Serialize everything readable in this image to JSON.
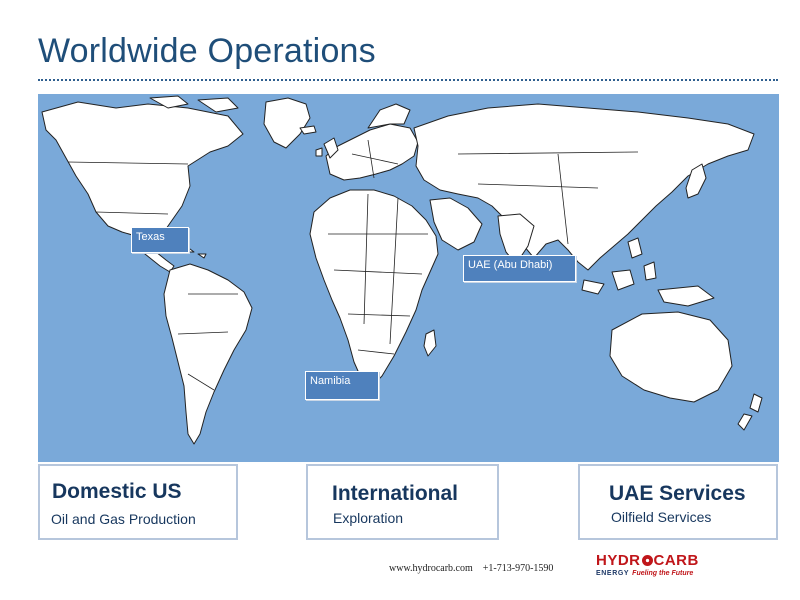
{
  "slide": {
    "title": "Worldwide Operations"
  },
  "map": {
    "ocean_color": "#7aa9d9",
    "land_color": "#ffffff",
    "labels": {
      "texas": "Texas",
      "uae": "UAE (Abu Dhabi)",
      "namibia": "Namibia"
    },
    "label_color": "#4f81bd"
  },
  "cards": {
    "domestic": {
      "title": "Domestic US",
      "subtitle": "Oil and Gas Production"
    },
    "international": {
      "title": "International",
      "subtitle": "Exploration"
    },
    "uae": {
      "title": "UAE Services",
      "subtitle": "Oilfield Services"
    }
  },
  "footer": {
    "website": "www.hydrocarb.com",
    "phone": "+1-713-970-1590"
  },
  "logo": {
    "name_left": "HYDR",
    "name_right": "CARB",
    "line_left": "ENERGY",
    "tagline": "Fueling the Future",
    "brand_color": "#c0161a"
  },
  "colors": {
    "title": "#1f4e79",
    "card_text": "#17375e",
    "card_border": "#b6c6dc"
  }
}
